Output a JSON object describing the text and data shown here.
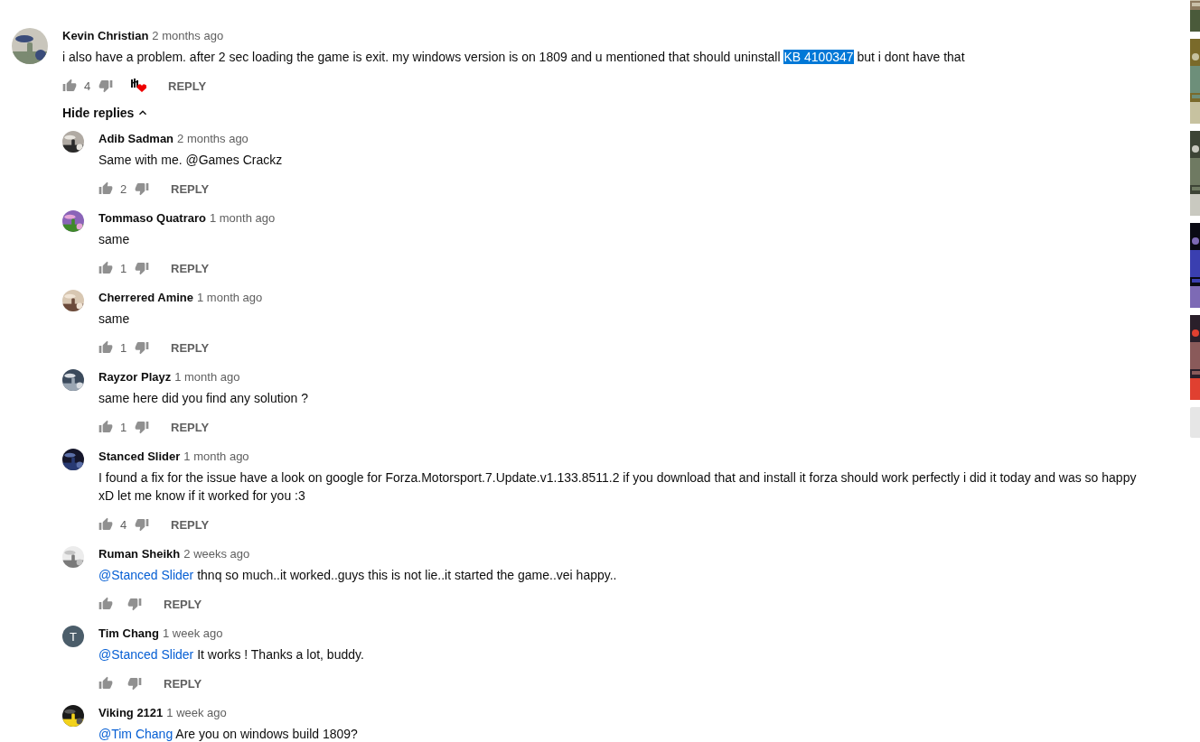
{
  "comment": {
    "author": "Kevin Christian",
    "time": "2 months ago",
    "avatar": {
      "kind": "picture"
    },
    "body": [
      {
        "kind": "plain",
        "text": "i also have a problem. after 2 sec loading the game is exit. my windows version is on 1809 and u mentioned that should uninstall "
      },
      {
        "kind": "selected",
        "text": "KB 4100347"
      },
      {
        "kind": "plain",
        "text": " but i dont have that"
      }
    ],
    "likes": "4",
    "creator_heart": true,
    "reply_label": "REPLY"
  },
  "replies_toggle": {
    "label": "Hide replies",
    "expanded": true
  },
  "replies": [
    {
      "author": "Adib Sadman",
      "time": "2 months ago",
      "avatar": {
        "kind": "picture"
      },
      "body": [
        {
          "kind": "plain",
          "text": "Same with me. @Games Crackz"
        }
      ],
      "likes": "2",
      "reply_label": "REPLY"
    },
    {
      "author": "Tommaso Quatraro",
      "time": "1 month ago",
      "avatar": {
        "kind": "picture"
      },
      "body": [
        {
          "kind": "plain",
          "text": "same"
        }
      ],
      "likes": "1",
      "reply_label": "REPLY"
    },
    {
      "author": "Cherrered Amine",
      "time": "1 month ago",
      "avatar": {
        "kind": "picture"
      },
      "body": [
        {
          "kind": "plain",
          "text": "same"
        }
      ],
      "likes": "1",
      "reply_label": "REPLY"
    },
    {
      "author": "Rayzor Playz",
      "time": "1 month ago",
      "avatar": {
        "kind": "picture"
      },
      "body": [
        {
          "kind": "plain",
          "text": "same here did you find any solution ?"
        }
      ],
      "likes": "1",
      "reply_label": "REPLY"
    },
    {
      "author": "Stanced Slider",
      "time": "1 month ago",
      "avatar": {
        "kind": "picture"
      },
      "body": [
        {
          "kind": "plain",
          "text": "I found a fix for the issue have a look on google for Forza.Motorsport.7.Update.v1.133.8511.2 if you download that and install it forza should work perfectly i did it today and was so happy xD let me know if it worked for you :3"
        }
      ],
      "likes": "4",
      "reply_label": "REPLY"
    },
    {
      "author": "Ruman Sheikh",
      "time": "2 weeks ago",
      "avatar": {
        "kind": "picture"
      },
      "body": [
        {
          "kind": "mention",
          "text": "@Stanced Slider"
        },
        {
          "kind": "plain",
          "text": " thnq so much..it worked..guys this is not lie..it started the game..vei happy.."
        }
      ],
      "reply_label": "REPLY"
    },
    {
      "author": "Tim Chang",
      "time": "1 week ago",
      "avatar": {
        "kind": "letter",
        "letter": "T"
      },
      "body": [
        {
          "kind": "mention",
          "text": "@Stanced Slider"
        },
        {
          "kind": "plain",
          "text": " It works ! Thanks a lot, buddy."
        }
      ],
      "reply_label": "REPLY"
    },
    {
      "author": "Viking 2121",
      "time": "1 week ago",
      "avatar": {
        "kind": "picture"
      },
      "body": [
        {
          "kind": "mention",
          "text": "@Tim Chang"
        },
        {
          "kind": "plain",
          "text": " Are you on windows build 1809?"
        }
      ]
    }
  ],
  "side_thumbnails": [
    {
      "kind": "picture"
    },
    {
      "kind": "picture"
    },
    {
      "kind": "picture"
    },
    {
      "kind": "picture"
    },
    {
      "kind": "picture"
    },
    {
      "kind": "placeholder"
    }
  ]
}
